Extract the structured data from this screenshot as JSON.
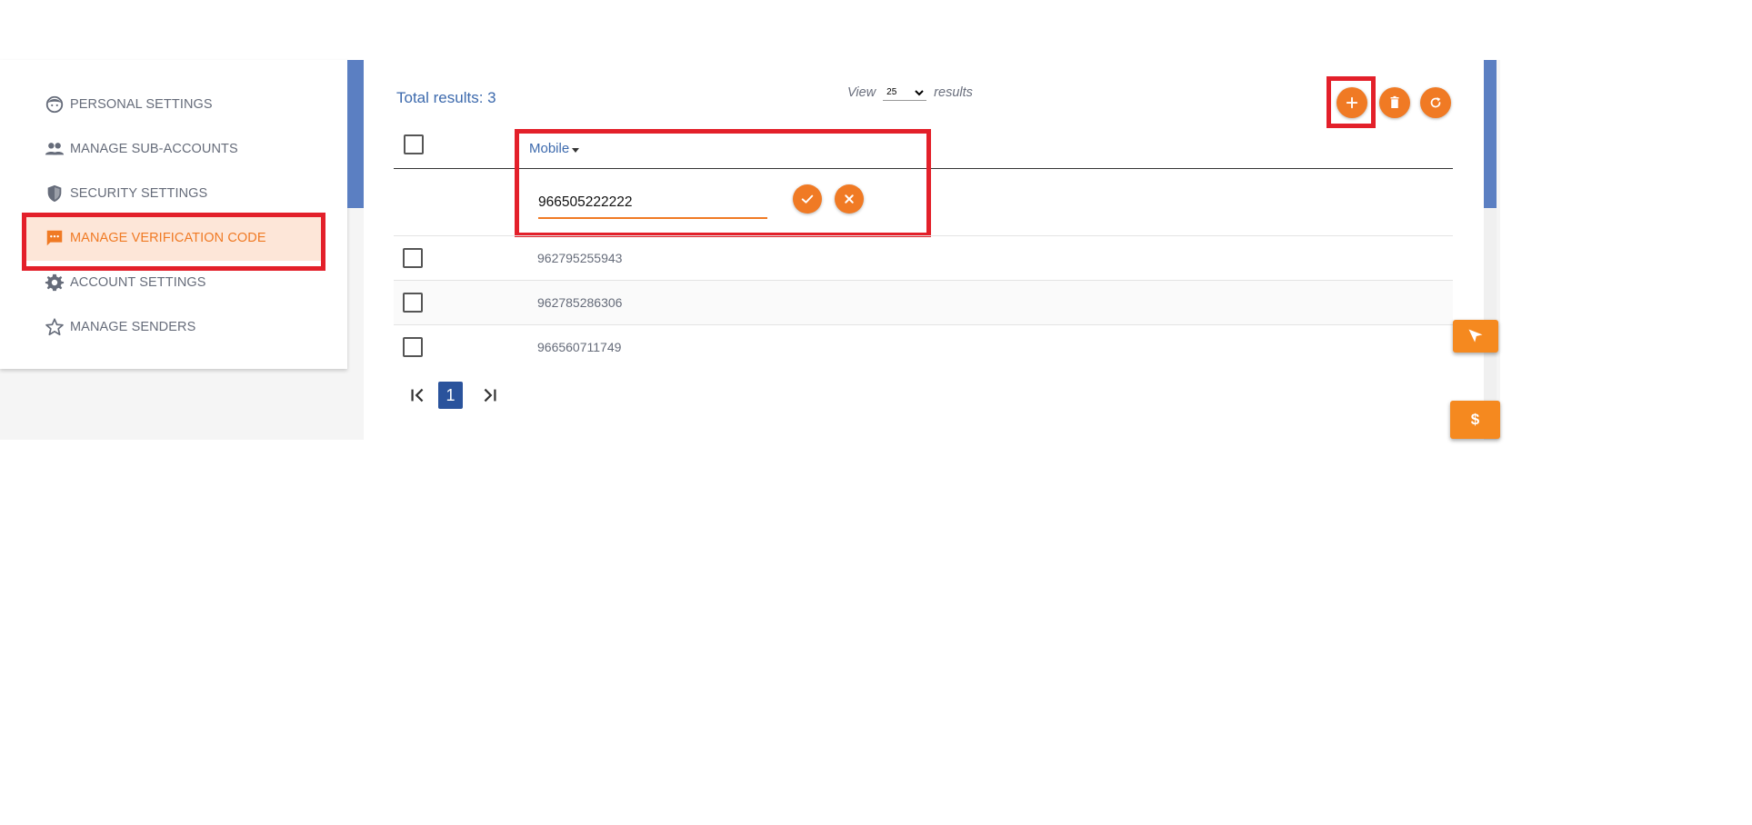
{
  "sidebar": {
    "items": [
      {
        "label": "PERSONAL SETTINGS",
        "icon": "face-icon"
      },
      {
        "label": "MANAGE SUB-ACCOUNTS",
        "icon": "people-icon"
      },
      {
        "label": "SECURITY SETTINGS",
        "icon": "shield-icon"
      },
      {
        "label": "MANAGE VERIFICATION CODE",
        "icon": "chat-icon",
        "active": true
      },
      {
        "label": "ACCOUNT SETTINGS",
        "icon": "gear-icon"
      },
      {
        "label": "MANAGE SENDERS",
        "icon": "star-icon"
      }
    ]
  },
  "main": {
    "total_results": "Total results: 3",
    "view_label": "View",
    "view_value": "25",
    "view_options": [
      "25"
    ],
    "results_label": "results",
    "column_header": "Mobile",
    "filter_value": "966505222222",
    "rows": [
      {
        "mobile": "962795255943"
      },
      {
        "mobile": "962785286306"
      },
      {
        "mobile": "966560711749"
      }
    ],
    "pagination": {
      "first": "|<",
      "current": "1",
      "last": ">|"
    }
  },
  "toolbar": {
    "add_icon": "plus-icon",
    "delete_icon": "trash-icon",
    "refresh_icon": "refresh-icon"
  },
  "floating": {
    "send_icon": "send-icon",
    "dollar_label": "$"
  },
  "colors": {
    "accent": "#f07a24",
    "primary_blue": "#3d6aad",
    "active_bg": "#fde6d8",
    "highlight": "#e3202a"
  }
}
